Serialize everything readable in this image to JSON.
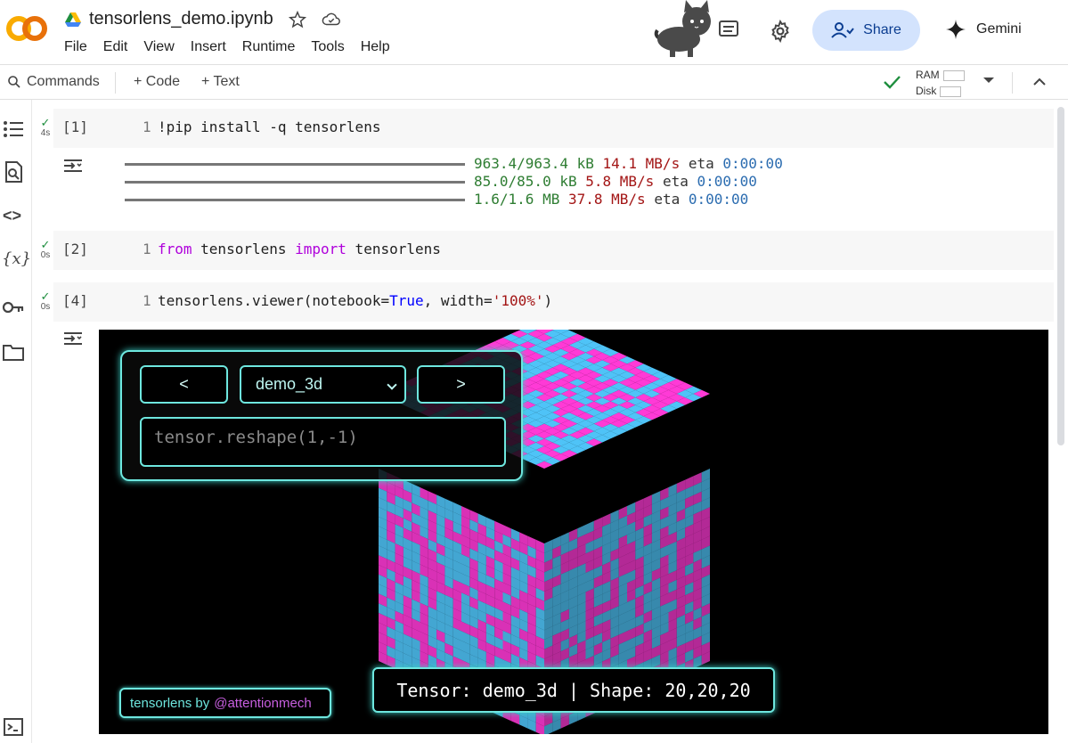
{
  "app": {
    "logo_text": "CO",
    "notebook_title": "tensorlens_demo.ipynb",
    "menu": [
      "File",
      "Edit",
      "View",
      "Insert",
      "Runtime",
      "Tools",
      "Help"
    ],
    "share_label": "Share",
    "gemini_label": "Gemini"
  },
  "toolbar": {
    "commands_label": "Commands",
    "add_code_label": "+ Code",
    "add_text_label": "+ Text",
    "ram_label": "RAM",
    "disk_label": "Disk"
  },
  "cells": [
    {
      "exec": "[1]",
      "time": "4s",
      "line": "1",
      "code": "!pip install -q tensorlens"
    },
    {
      "exec": "[2]",
      "time": "0s",
      "line": "1",
      "code_parts": [
        "from",
        " tensorlens ",
        "import",
        " tensorlens"
      ]
    },
    {
      "exec": "[4]",
      "time": "0s",
      "line": "1",
      "code_parts": [
        "tensorlens.viewer(notebook=",
        "True",
        ", width=",
        "'100%'",
        ")"
      ]
    }
  ],
  "pip_output": [
    {
      "size": "963.4/963.4 kB",
      "speed": "14.1 MB/s",
      "eta_label": "eta",
      "eta": "0:00:00"
    },
    {
      "size": "85.0/85.0 kB",
      "speed": "5.8 MB/s",
      "eta_label": "eta",
      "eta": "0:00:00"
    },
    {
      "size": "1.6/1.6 MB",
      "speed": "37.8 MB/s",
      "eta_label": "eta",
      "eta": "0:00:00"
    }
  ],
  "viewer": {
    "prev_label": "<",
    "next_label": ">",
    "selected_tensor": "demo_3d",
    "expression_placeholder": "tensor.reshape(1,-1)",
    "credit_prefix": "tensorlens by",
    "credit_handle": "@attentionmech",
    "info": "Tensor: demo_3d | Shape: 20,20,20",
    "colors": {
      "accent": "#6ee7df",
      "voxel_a": "#ff3ad6",
      "voxel_b": "#4fc3f7"
    }
  }
}
